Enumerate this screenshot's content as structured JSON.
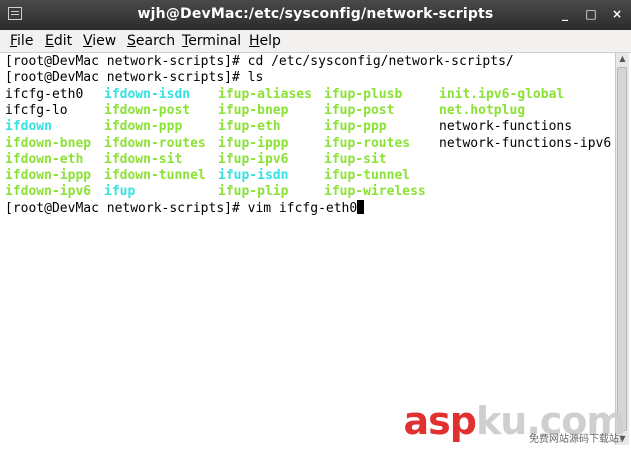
{
  "window": {
    "title": "wjh@DevMac:/etc/sysconfig/network-scripts",
    "buttons": [
      "_",
      "□",
      "×"
    ]
  },
  "menubar": {
    "items": [
      {
        "label": "File",
        "mnemonic": "F",
        "rest": "ile"
      },
      {
        "label": "Edit",
        "mnemonic": "E",
        "rest": "dit"
      },
      {
        "label": "View",
        "mnemonic": "V",
        "rest": "iew"
      },
      {
        "label": "Search",
        "mnemonic": "S",
        "rest": "earch"
      },
      {
        "label": "Terminal",
        "mnemonic": "T",
        "rest": "erminal"
      },
      {
        "label": "Help",
        "mnemonic": "H",
        "rest": "elp"
      }
    ]
  },
  "terminal": {
    "lines": [
      "[root@DevMac network-scripts]# cd /etc/sysconfig/network-scripts/",
      "[root@DevMac network-scripts]# ls"
    ],
    "ls_rows": [
      [
        {
          "t": "ifcfg-eth0",
          "c": "reg"
        },
        {
          "t": "ifdown-isdn",
          "c": "lnk"
        },
        {
          "t": "ifup-aliases",
          "c": "exe"
        },
        {
          "t": "ifup-plusb",
          "c": "exe"
        },
        {
          "t": "init.ipv6-global",
          "c": "exe"
        }
      ],
      [
        {
          "t": "ifcfg-lo",
          "c": "reg"
        },
        {
          "t": "ifdown-post",
          "c": "exe"
        },
        {
          "t": "ifup-bnep",
          "c": "exe"
        },
        {
          "t": "ifup-post",
          "c": "exe"
        },
        {
          "t": "net.hotplug",
          "c": "exe"
        }
      ],
      [
        {
          "t": "ifdown",
          "c": "lnk"
        },
        {
          "t": "ifdown-ppp",
          "c": "exe"
        },
        {
          "t": "ifup-eth",
          "c": "exe"
        },
        {
          "t": "ifup-ppp",
          "c": "exe"
        },
        {
          "t": "network-functions",
          "c": "reg"
        }
      ],
      [
        {
          "t": "ifdown-bnep",
          "c": "exe"
        },
        {
          "t": "ifdown-routes",
          "c": "exe"
        },
        {
          "t": "ifup-ippp",
          "c": "exe"
        },
        {
          "t": "ifup-routes",
          "c": "exe"
        },
        {
          "t": "network-functions-ipv6",
          "c": "reg"
        }
      ],
      [
        {
          "t": "ifdown-eth",
          "c": "exe"
        },
        {
          "t": "ifdown-sit",
          "c": "exe"
        },
        {
          "t": "ifup-ipv6",
          "c": "exe"
        },
        {
          "t": "ifup-sit",
          "c": "exe"
        },
        {
          "t": "",
          "c": "reg"
        }
      ],
      [
        {
          "t": "ifdown-ippp",
          "c": "exe"
        },
        {
          "t": "ifdown-tunnel",
          "c": "exe"
        },
        {
          "t": "ifup-isdn",
          "c": "lnk"
        },
        {
          "t": "ifup-tunnel",
          "c": "exe"
        },
        {
          "t": "",
          "c": "reg"
        }
      ],
      [
        {
          "t": "ifdown-ipv6",
          "c": "exe"
        },
        {
          "t": "ifup",
          "c": "lnk"
        },
        {
          "t": "ifup-plip",
          "c": "exe"
        },
        {
          "t": "ifup-wireless",
          "c": "exe"
        },
        {
          "t": "",
          "c": "reg"
        }
      ]
    ],
    "prompt_current": "[root@DevMac network-scripts]# vim ifcfg-eth0"
  },
  "watermark": {
    "brand_a": "asp",
    "brand_b": "ku",
    "brand_c": ".com",
    "subtitle": "免费网站源码下载站!"
  },
  "colors": {
    "executable": "#8ae234",
    "symlink": "#34e2e2",
    "text": "#000000",
    "watermark": "#e03030"
  }
}
